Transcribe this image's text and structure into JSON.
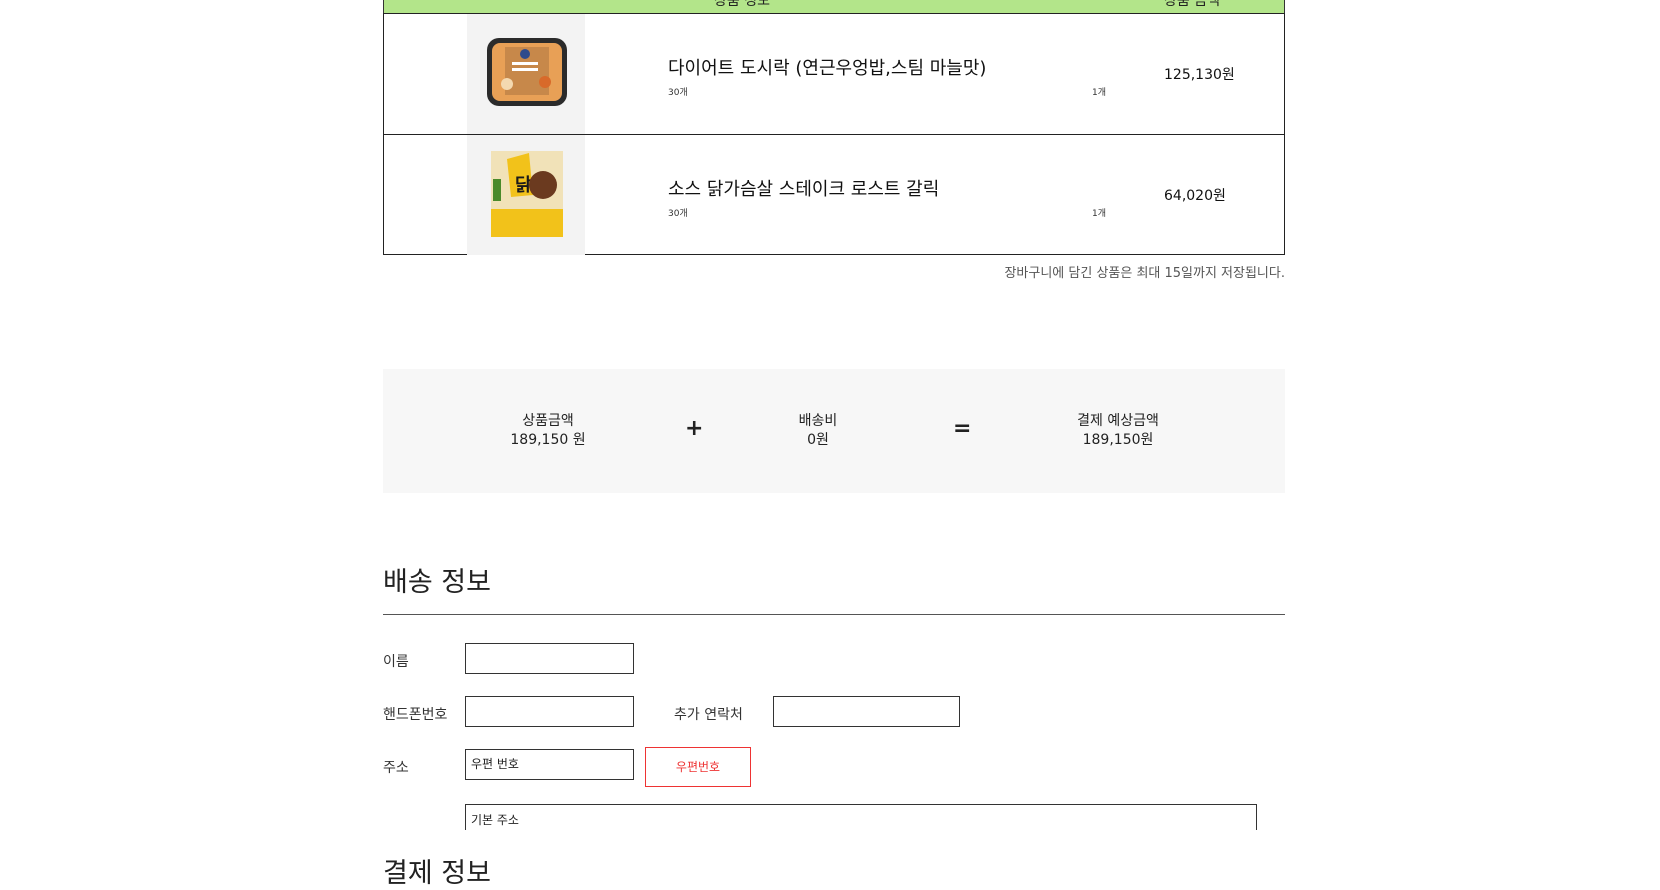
{
  "cart": {
    "header_info": "상품 정보",
    "header_price": "상품 금액",
    "items": [
      {
        "name": "다이어트 도시락 (연근우엉밥,스팀 마늘맛)",
        "option": "30개",
        "count": "1개",
        "price": "125,130원"
      },
      {
        "name": "소스 닭가슴살 스테이크 로스트 갈릭",
        "option": "30개",
        "count": "1개",
        "price": "64,020원"
      }
    ],
    "note": "장바구니에 담긴 상품은 최대 15일까지 저장됩니다."
  },
  "summary": {
    "product_label": "상품금액",
    "product_value": "189,150 원",
    "plus": "+",
    "shipping_label": "배송비",
    "shipping_value": "0원",
    "equals": "=",
    "total_label": "결제 예상금액",
    "total_value": "189,150원"
  },
  "delivery": {
    "title": "배송 정보",
    "name_label": "이름",
    "phone_label": "핸드폰번호",
    "extra_contact_label": "추가 연락처",
    "address_label": "주소",
    "zip_value": "우편 번호",
    "zip_button": "우편번호",
    "base_address_value": "기본 주소"
  },
  "payment": {
    "title": "결제 정보"
  },
  "colors": {
    "header_green": "#b3e58a",
    "accent_red": "#e33333",
    "summary_bg": "#f7f7f7"
  }
}
